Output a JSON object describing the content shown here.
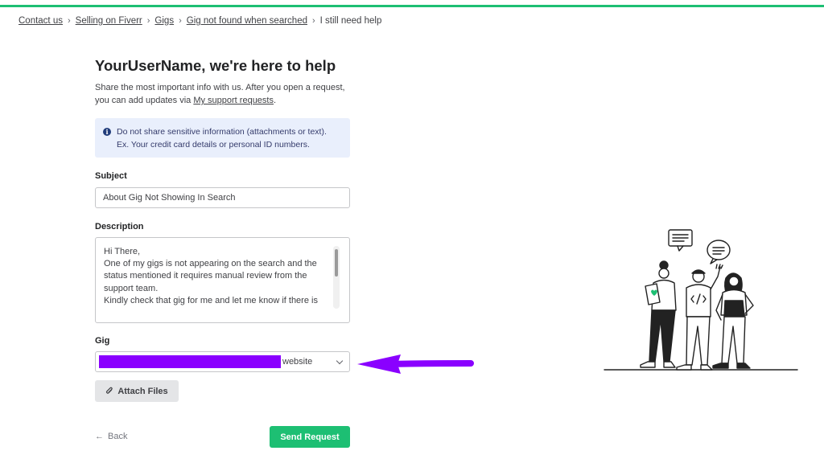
{
  "breadcrumb": {
    "items": [
      "Contact us",
      "Selling on Fiverr",
      "Gigs",
      "Gig not found when searched"
    ],
    "current": "I still need help"
  },
  "header": {
    "title": "YourUserName, we're here to help",
    "intro_text": "Share the most important info with us. After you open a request, you can add updates via",
    "intro_link": "My support requests",
    "intro_end": "."
  },
  "notice": {
    "line1": "Do not share sensitive information (attachments or text).",
    "line2": "Ex. Your credit card details or personal ID numbers."
  },
  "form": {
    "subject_label": "Subject",
    "subject_value": "About Gig Not Showing In Search",
    "description_label": "Description",
    "description_value": "Hi There,\nOne of my gigs is not appearing on the search and the status mentioned it requires manual review from the support team.\nKindly check that gig for me and let me know if there is",
    "gig_label": "Gig",
    "gig_value": "website",
    "attach_label": "Attach Files",
    "back_label": "Back",
    "send_label": "Send Request"
  },
  "colors": {
    "brand_green": "#1dbf73",
    "redaction": "#8a00ff",
    "notice_bg": "#e9effc"
  }
}
